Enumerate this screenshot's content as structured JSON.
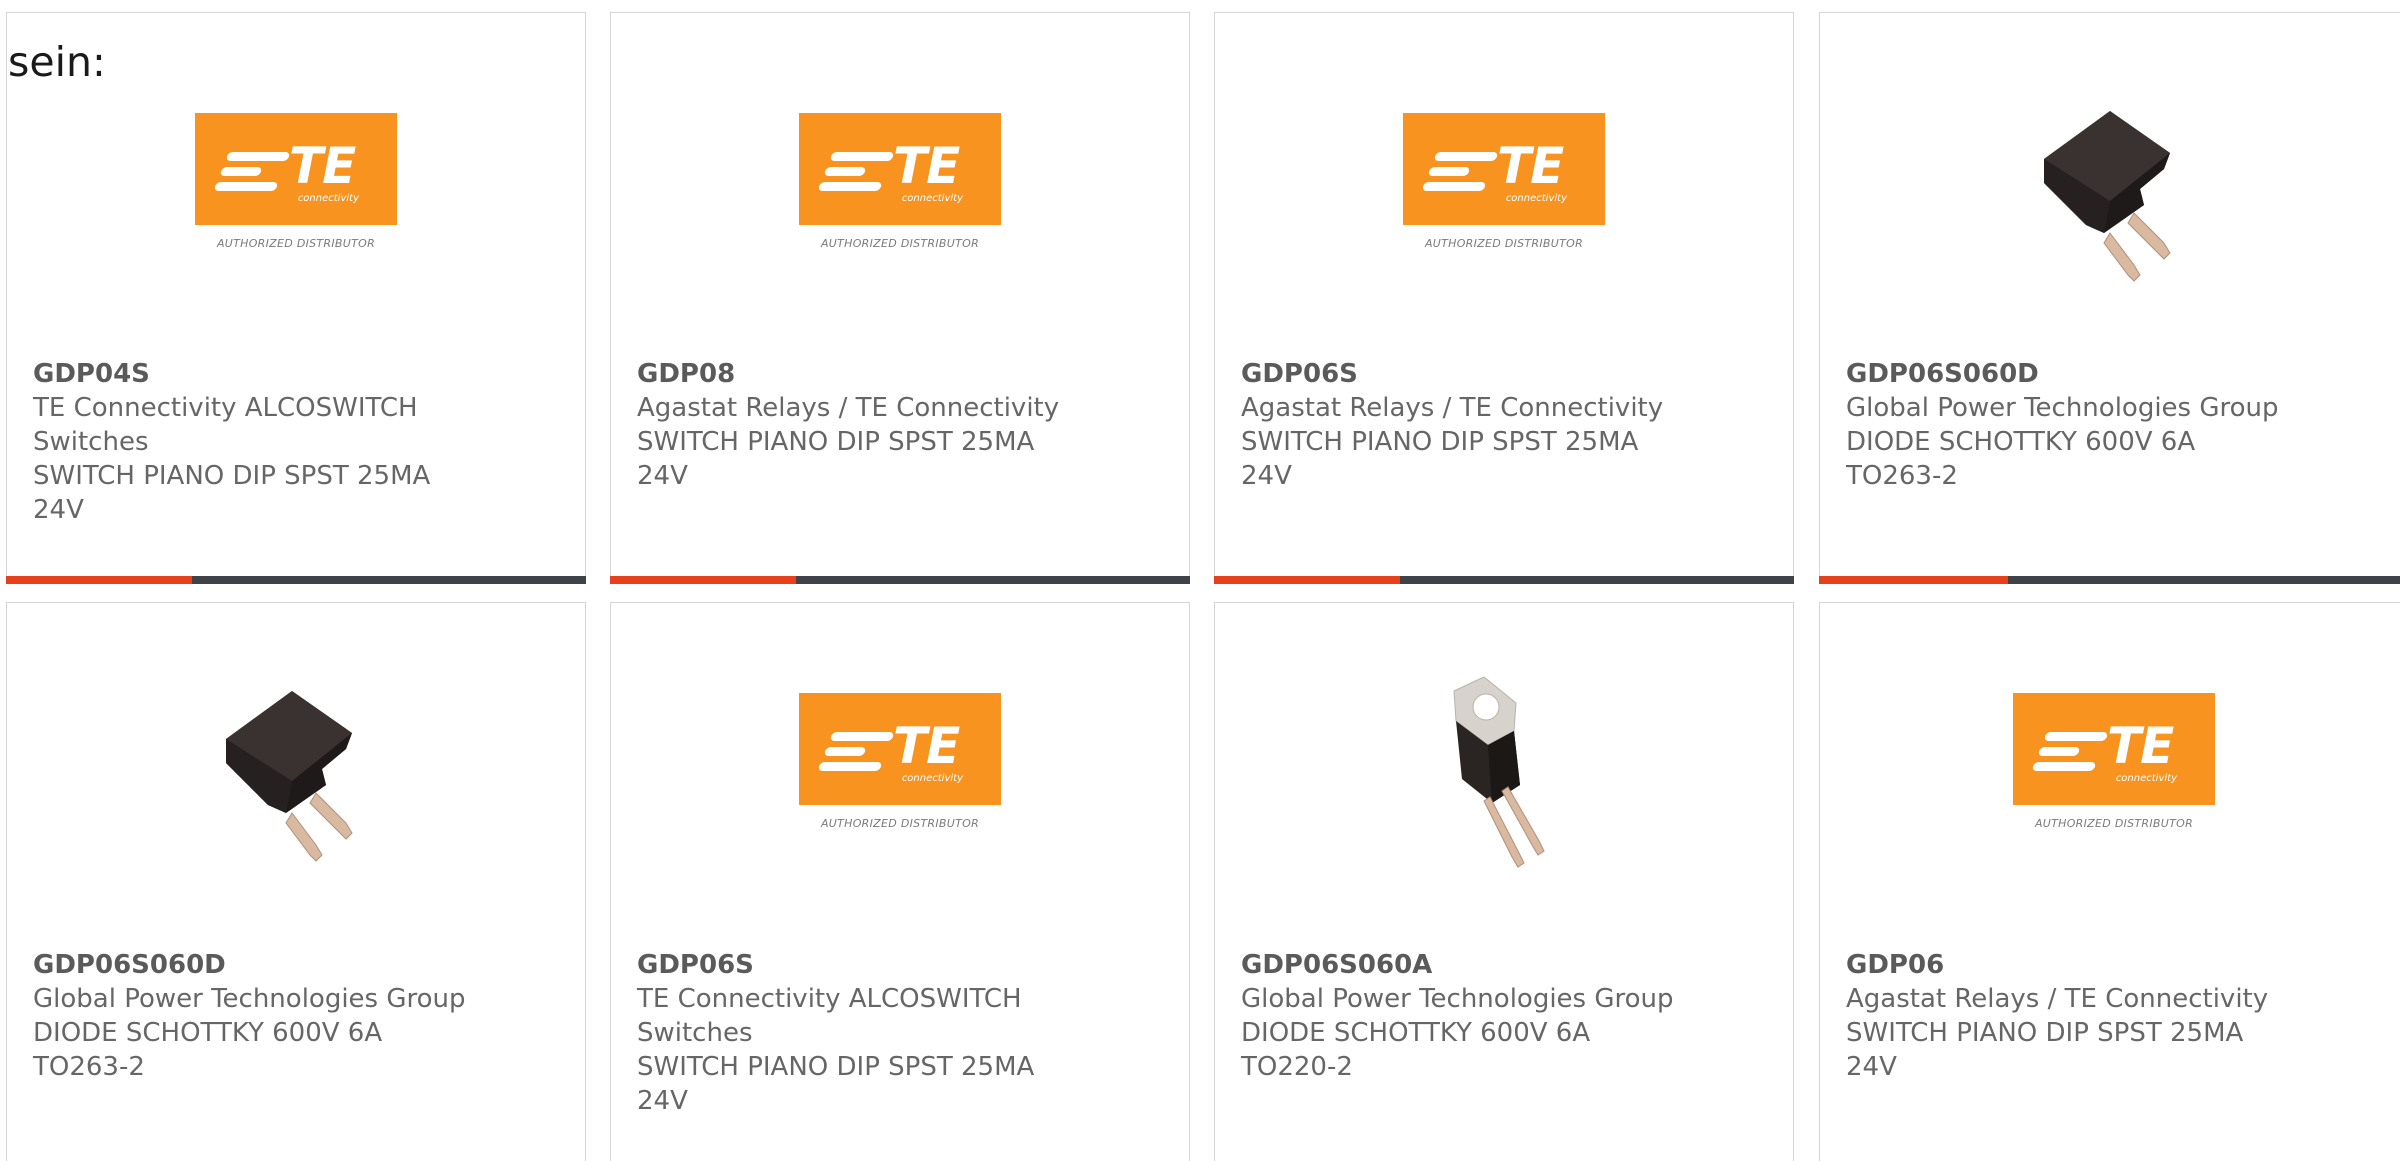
{
  "intro": "sein:",
  "colors": {
    "accent": "#e8401c",
    "bar_track": "#3f4347",
    "te_orange": "#f7931e"
  },
  "te_logo": {
    "letters": "TE",
    "subtitle": "connectivity",
    "tagline": "AUTHORIZED DISTRIBUTOR"
  },
  "cards": [
    {
      "image": "te-authorized-distributor-logo",
      "part": "GDP04S",
      "lines": [
        "TE Connectivity ALCOSWITCH",
        "Switches",
        "SWITCH PIANO DIP SPST 25MA",
        "24V"
      ],
      "progress": 0.32
    },
    {
      "image": "te-authorized-distributor-logo",
      "part": "GDP08",
      "lines": [
        "Agastat Relays / TE Connectivity",
        "SWITCH PIANO DIP SPST 25MA",
        "24V"
      ],
      "progress": 0.32
    },
    {
      "image": "te-authorized-distributor-logo",
      "part": "GDP06S",
      "lines": [
        "Agastat Relays / TE Connectivity",
        "SWITCH PIANO DIP SPST 25MA",
        "24V"
      ],
      "progress": 0.32
    },
    {
      "image": "to263-diode-package",
      "part": "GDP06S060D",
      "lines": [
        "Global Power Technologies Group",
        "DIODE SCHOTTKY 600V 6A",
        "TO263-2"
      ],
      "progress": 0.32
    },
    {
      "image": "to263-diode-package",
      "part": "GDP06S060D",
      "lines": [
        "Global Power Technologies Group",
        "DIODE SCHOTTKY 600V 6A",
        "TO263-2"
      ]
    },
    {
      "image": "te-authorized-distributor-logo",
      "part": "GDP06S",
      "lines": [
        "TE Connectivity ALCOSWITCH",
        "Switches",
        "SWITCH PIANO DIP SPST 25MA",
        "24V"
      ]
    },
    {
      "image": "to220-diode-package",
      "part": "GDP06S060A",
      "lines": [
        "Global Power Technologies Group",
        "DIODE SCHOTTKY 600V 6A",
        "TO220-2"
      ]
    },
    {
      "image": "te-authorized-distributor-logo",
      "part": "GDP06",
      "lines": [
        "Agastat Relays / TE Connectivity",
        "SWITCH PIANO DIP SPST 25MA",
        "24V"
      ]
    }
  ]
}
